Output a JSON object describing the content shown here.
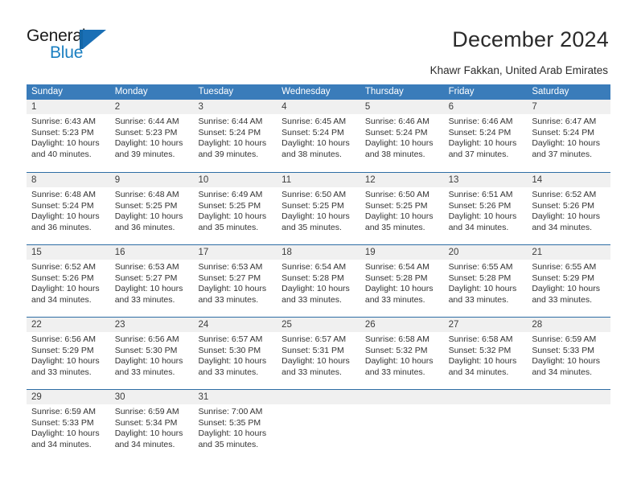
{
  "brand": {
    "name_top": "General",
    "name_bottom": "Blue",
    "accent_color": "#1a7fc1"
  },
  "header": {
    "title": "December 2024",
    "subtitle": "Khawr Fakkan, United Arab Emirates"
  },
  "theme": {
    "header_row_bg": "#3a7cba",
    "row_separator": "#2e6da4",
    "daynum_band_bg": "#f0f0f0",
    "text": "#333333"
  },
  "calendar": {
    "weekday_headers": [
      "Sunday",
      "Monday",
      "Tuesday",
      "Wednesday",
      "Thursday",
      "Friday",
      "Saturday"
    ],
    "weeks": [
      [
        {
          "day": "1",
          "sunrise": "Sunrise: 6:43 AM",
          "sunset": "Sunset: 5:23 PM",
          "daylight1": "Daylight: 10 hours",
          "daylight2": "and 40 minutes."
        },
        {
          "day": "2",
          "sunrise": "Sunrise: 6:44 AM",
          "sunset": "Sunset: 5:23 PM",
          "daylight1": "Daylight: 10 hours",
          "daylight2": "and 39 minutes."
        },
        {
          "day": "3",
          "sunrise": "Sunrise: 6:44 AM",
          "sunset": "Sunset: 5:24 PM",
          "daylight1": "Daylight: 10 hours",
          "daylight2": "and 39 minutes."
        },
        {
          "day": "4",
          "sunrise": "Sunrise: 6:45 AM",
          "sunset": "Sunset: 5:24 PM",
          "daylight1": "Daylight: 10 hours",
          "daylight2": "and 38 minutes."
        },
        {
          "day": "5",
          "sunrise": "Sunrise: 6:46 AM",
          "sunset": "Sunset: 5:24 PM",
          "daylight1": "Daylight: 10 hours",
          "daylight2": "and 38 minutes."
        },
        {
          "day": "6",
          "sunrise": "Sunrise: 6:46 AM",
          "sunset": "Sunset: 5:24 PM",
          "daylight1": "Daylight: 10 hours",
          "daylight2": "and 37 minutes."
        },
        {
          "day": "7",
          "sunrise": "Sunrise: 6:47 AM",
          "sunset": "Sunset: 5:24 PM",
          "daylight1": "Daylight: 10 hours",
          "daylight2": "and 37 minutes."
        }
      ],
      [
        {
          "day": "8",
          "sunrise": "Sunrise: 6:48 AM",
          "sunset": "Sunset: 5:24 PM",
          "daylight1": "Daylight: 10 hours",
          "daylight2": "and 36 minutes."
        },
        {
          "day": "9",
          "sunrise": "Sunrise: 6:48 AM",
          "sunset": "Sunset: 5:25 PM",
          "daylight1": "Daylight: 10 hours",
          "daylight2": "and 36 minutes."
        },
        {
          "day": "10",
          "sunrise": "Sunrise: 6:49 AM",
          "sunset": "Sunset: 5:25 PM",
          "daylight1": "Daylight: 10 hours",
          "daylight2": "and 35 minutes."
        },
        {
          "day": "11",
          "sunrise": "Sunrise: 6:50 AM",
          "sunset": "Sunset: 5:25 PM",
          "daylight1": "Daylight: 10 hours",
          "daylight2": "and 35 minutes."
        },
        {
          "day": "12",
          "sunrise": "Sunrise: 6:50 AM",
          "sunset": "Sunset: 5:25 PM",
          "daylight1": "Daylight: 10 hours",
          "daylight2": "and 35 minutes."
        },
        {
          "day": "13",
          "sunrise": "Sunrise: 6:51 AM",
          "sunset": "Sunset: 5:26 PM",
          "daylight1": "Daylight: 10 hours",
          "daylight2": "and 34 minutes."
        },
        {
          "day": "14",
          "sunrise": "Sunrise: 6:52 AM",
          "sunset": "Sunset: 5:26 PM",
          "daylight1": "Daylight: 10 hours",
          "daylight2": "and 34 minutes."
        }
      ],
      [
        {
          "day": "15",
          "sunrise": "Sunrise: 6:52 AM",
          "sunset": "Sunset: 5:26 PM",
          "daylight1": "Daylight: 10 hours",
          "daylight2": "and 34 minutes."
        },
        {
          "day": "16",
          "sunrise": "Sunrise: 6:53 AM",
          "sunset": "Sunset: 5:27 PM",
          "daylight1": "Daylight: 10 hours",
          "daylight2": "and 33 minutes."
        },
        {
          "day": "17",
          "sunrise": "Sunrise: 6:53 AM",
          "sunset": "Sunset: 5:27 PM",
          "daylight1": "Daylight: 10 hours",
          "daylight2": "and 33 minutes."
        },
        {
          "day": "18",
          "sunrise": "Sunrise: 6:54 AM",
          "sunset": "Sunset: 5:28 PM",
          "daylight1": "Daylight: 10 hours",
          "daylight2": "and 33 minutes."
        },
        {
          "day": "19",
          "sunrise": "Sunrise: 6:54 AM",
          "sunset": "Sunset: 5:28 PM",
          "daylight1": "Daylight: 10 hours",
          "daylight2": "and 33 minutes."
        },
        {
          "day": "20",
          "sunrise": "Sunrise: 6:55 AM",
          "sunset": "Sunset: 5:28 PM",
          "daylight1": "Daylight: 10 hours",
          "daylight2": "and 33 minutes."
        },
        {
          "day": "21",
          "sunrise": "Sunrise: 6:55 AM",
          "sunset": "Sunset: 5:29 PM",
          "daylight1": "Daylight: 10 hours",
          "daylight2": "and 33 minutes."
        }
      ],
      [
        {
          "day": "22",
          "sunrise": "Sunrise: 6:56 AM",
          "sunset": "Sunset: 5:29 PM",
          "daylight1": "Daylight: 10 hours",
          "daylight2": "and 33 minutes."
        },
        {
          "day": "23",
          "sunrise": "Sunrise: 6:56 AM",
          "sunset": "Sunset: 5:30 PM",
          "daylight1": "Daylight: 10 hours",
          "daylight2": "and 33 minutes."
        },
        {
          "day": "24",
          "sunrise": "Sunrise: 6:57 AM",
          "sunset": "Sunset: 5:30 PM",
          "daylight1": "Daylight: 10 hours",
          "daylight2": "and 33 minutes."
        },
        {
          "day": "25",
          "sunrise": "Sunrise: 6:57 AM",
          "sunset": "Sunset: 5:31 PM",
          "daylight1": "Daylight: 10 hours",
          "daylight2": "and 33 minutes."
        },
        {
          "day": "26",
          "sunrise": "Sunrise: 6:58 AM",
          "sunset": "Sunset: 5:32 PM",
          "daylight1": "Daylight: 10 hours",
          "daylight2": "and 33 minutes."
        },
        {
          "day": "27",
          "sunrise": "Sunrise: 6:58 AM",
          "sunset": "Sunset: 5:32 PM",
          "daylight1": "Daylight: 10 hours",
          "daylight2": "and 34 minutes."
        },
        {
          "day": "28",
          "sunrise": "Sunrise: 6:59 AM",
          "sunset": "Sunset: 5:33 PM",
          "daylight1": "Daylight: 10 hours",
          "daylight2": "and 34 minutes."
        }
      ],
      [
        {
          "day": "29",
          "sunrise": "Sunrise: 6:59 AM",
          "sunset": "Sunset: 5:33 PM",
          "daylight1": "Daylight: 10 hours",
          "daylight2": "and 34 minutes."
        },
        {
          "day": "30",
          "sunrise": "Sunrise: 6:59 AM",
          "sunset": "Sunset: 5:34 PM",
          "daylight1": "Daylight: 10 hours",
          "daylight2": "and 34 minutes."
        },
        {
          "day": "31",
          "sunrise": "Sunrise: 7:00 AM",
          "sunset": "Sunset: 5:35 PM",
          "daylight1": "Daylight: 10 hours",
          "daylight2": "and 35 minutes."
        },
        {
          "day": "",
          "sunrise": "",
          "sunset": "",
          "daylight1": "",
          "daylight2": ""
        },
        {
          "day": "",
          "sunrise": "",
          "sunset": "",
          "daylight1": "",
          "daylight2": ""
        },
        {
          "day": "",
          "sunrise": "",
          "sunset": "",
          "daylight1": "",
          "daylight2": ""
        },
        {
          "day": "",
          "sunrise": "",
          "sunset": "",
          "daylight1": "",
          "daylight2": ""
        }
      ]
    ]
  }
}
